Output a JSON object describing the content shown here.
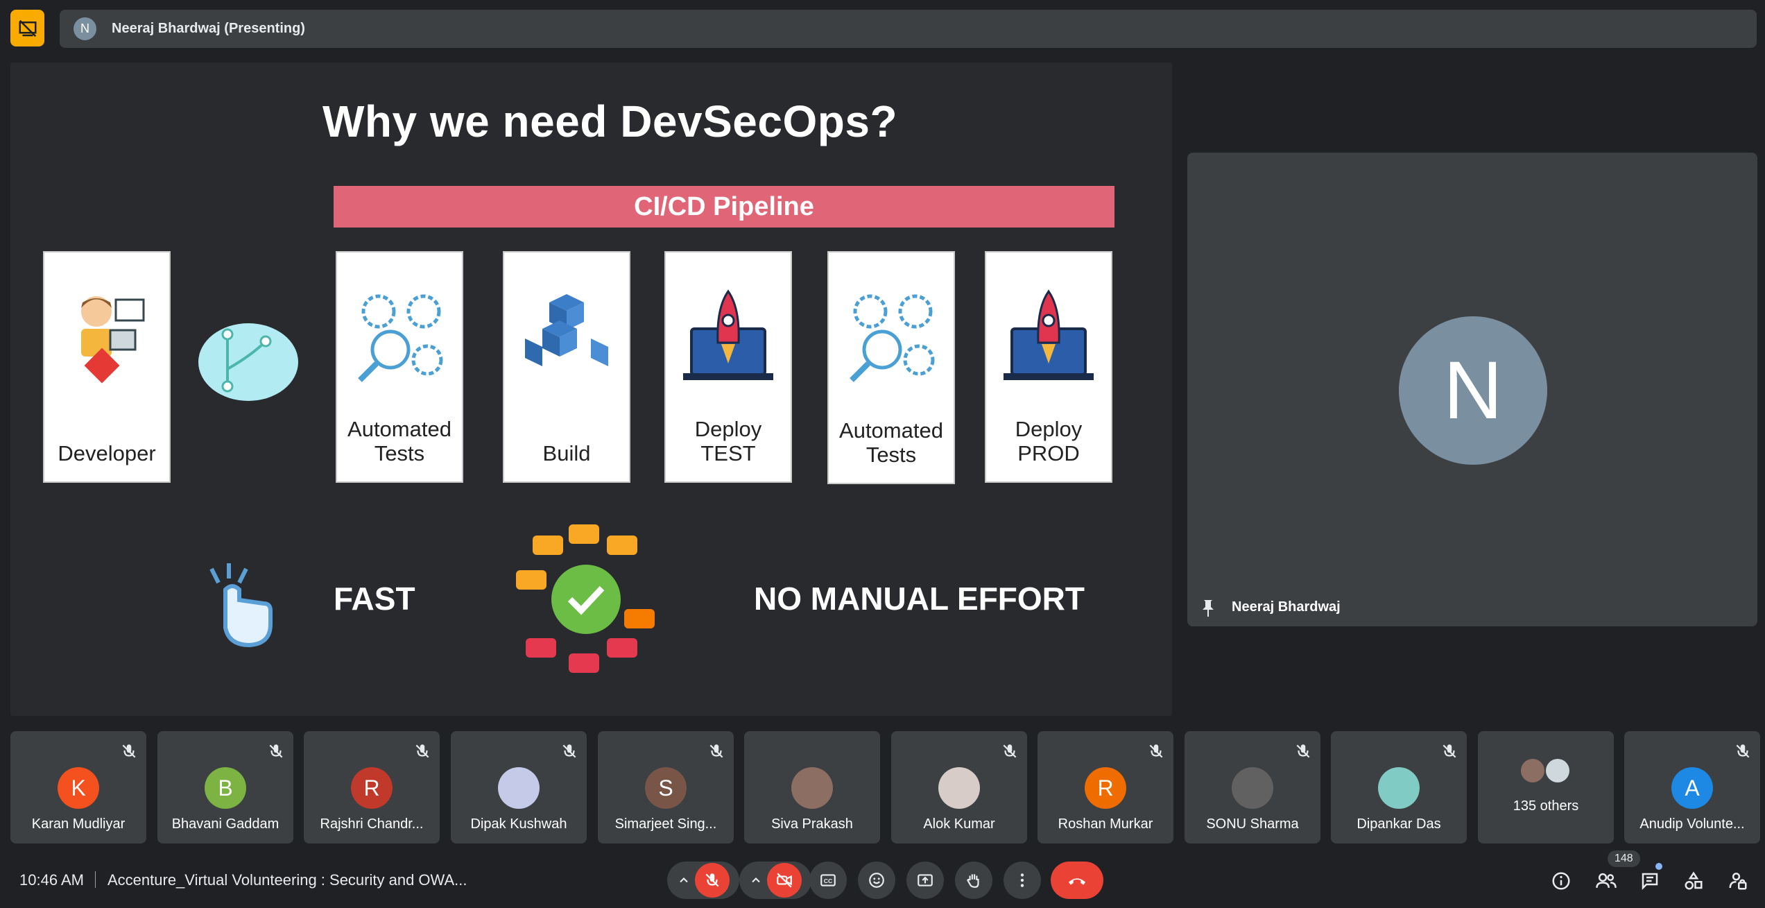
{
  "header": {
    "presenter_initial": "N",
    "presenter_label": "Neeraj Bhardwaj (Presenting)"
  },
  "slide": {
    "title": "Why we need DevSecOps?",
    "pipeline_label": "CI/CD Pipeline",
    "cards": [
      {
        "label": "Developer"
      },
      {
        "label": "Automated\nTests"
      },
      {
        "label": "Build"
      },
      {
        "label": "Deploy\nTEST"
      },
      {
        "label": "Automated\nTests"
      },
      {
        "label": "Deploy\nPROD"
      }
    ],
    "fast_label": "FAST",
    "no_manual_label": "NO MANUAL EFFORT"
  },
  "self_tile": {
    "initial": "N",
    "name": "Neeraj Bhardwaj"
  },
  "participants": [
    {
      "initial": "K",
      "name": "Karan Mudliyar",
      "color": "#f4511e",
      "muted": true
    },
    {
      "initial": "B",
      "name": "Bhavani Gaddam",
      "color": "#7cb342",
      "muted": true
    },
    {
      "initial": "R",
      "name": "Rajshri Chandr...",
      "color": "#c0392b",
      "muted": true
    },
    {
      "initial": "",
      "name": "Dipak Kushwah",
      "color": "#c5cae9",
      "muted": true
    },
    {
      "initial": "S",
      "name": "Simarjeet Sing...",
      "color": "#795548",
      "muted": true
    },
    {
      "initial": "",
      "name": "Siva Prakash",
      "color": "#8d6e63",
      "muted": false
    },
    {
      "initial": "",
      "name": "Alok Kumar",
      "color": "#d7ccc8",
      "muted": true
    },
    {
      "initial": "R",
      "name": "Roshan Murkar",
      "color": "#ef6c00",
      "muted": true
    },
    {
      "initial": "",
      "name": "SONU Sharma",
      "color": "#616161",
      "muted": true
    },
    {
      "initial": "",
      "name": "Dipankar Das",
      "color": "#80cbc4",
      "muted": true
    },
    {
      "initial": "",
      "name": "135 others",
      "color": "#9e9e9e",
      "muted": false
    },
    {
      "initial": "A",
      "name": "Anudip Volunte...",
      "color": "#1e88e5",
      "muted": true
    }
  ],
  "bottom_bar": {
    "time": "10:46 AM",
    "meeting_title": "Accenture_Virtual Volunteering : Security and OWA...",
    "participant_count": "148"
  }
}
